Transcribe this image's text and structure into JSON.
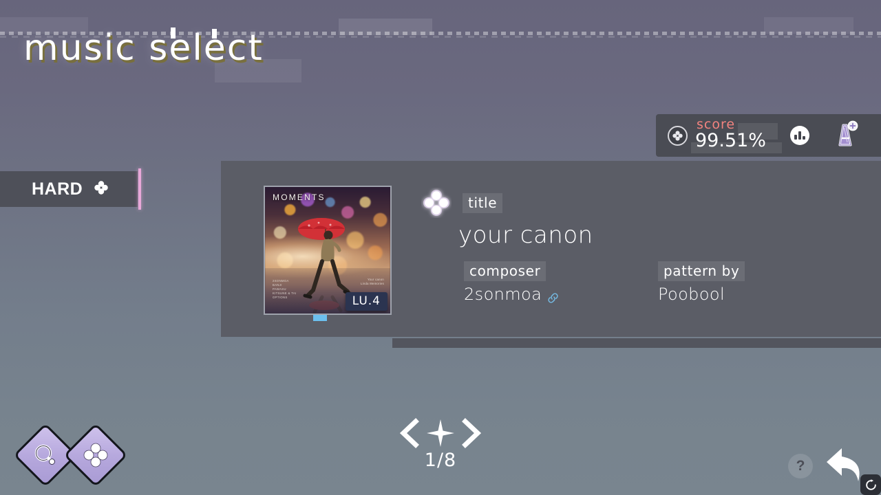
{
  "header": {
    "title": "music select"
  },
  "score_panel": {
    "label": "score",
    "value": "99.51%",
    "clover_icon": "clover-icon",
    "chart_icon": "bar-chart-icon",
    "rank": "A",
    "rank_plus": "+",
    "rank_icon": "rank-a-plus-icon"
  },
  "difficulty": {
    "label": "HARD",
    "icon": "clover-icon"
  },
  "song": {
    "album": {
      "title": "MOMENTS",
      "level": "LU.4",
      "credits_left": [
        "2SONMOA",
        "BANJI",
        "PAWASU",
        "KITSUNE & TAI",
        "OPTIONS"
      ],
      "credits_right": [
        "Your canon",
        "Linda Memories"
      ]
    },
    "title_label": "title",
    "title": "your canon",
    "composer_label": "composer",
    "composer": "2sonmoa",
    "composer_link_icon": "link-icon",
    "pattern_label": "pattern  by",
    "pattern_by": "Poobool",
    "title_icon": "clover-icon"
  },
  "pager": {
    "prev_icon": "chevron-left-icon",
    "star_icon": "star-icon",
    "next_icon": "chevron-right-icon",
    "count": "1/8"
  },
  "bottom_left_buttons": [
    {
      "name": "search-button",
      "icon": "search-icon"
    },
    {
      "name": "clover-button",
      "icon": "clover-icon"
    }
  ],
  "bottom_right": {
    "help_label": "?",
    "back_icon": "back-arrow-icon",
    "refresh_icon": "refresh-icon"
  },
  "colors": {
    "accent_pink": "#e8a8d8",
    "score_label": "#f2837f",
    "card_bg": "#5b5d66",
    "panel_bg": "#4a4c54",
    "tab_blue": "#6cc0ee",
    "rank_purple": "#9b8bc9",
    "title_shadow": "#7a7030"
  }
}
